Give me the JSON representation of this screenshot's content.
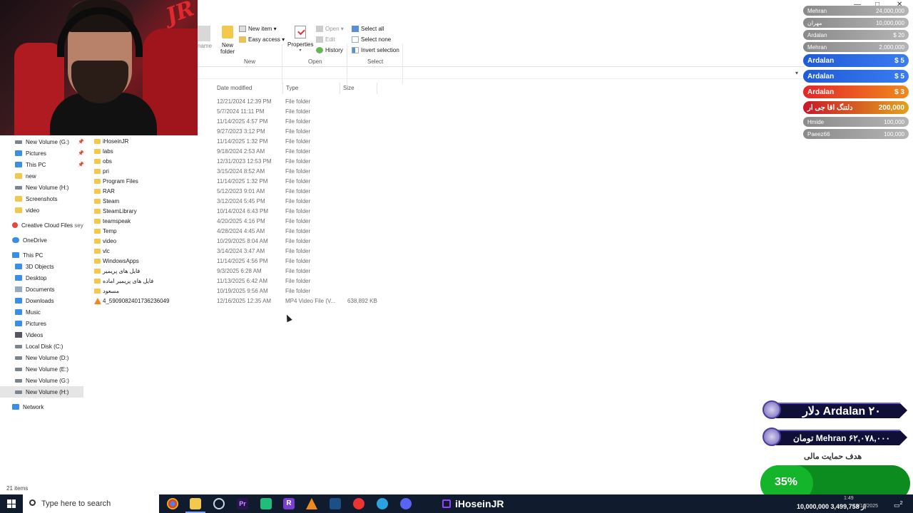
{
  "ribbon": {
    "new_folder": "New\nfolder",
    "new_item": "New item ▾",
    "easy_access": "Easy access ▾",
    "group_new": "New",
    "properties": "Properties",
    "open": "Open ▾",
    "edit": "Edit",
    "history": "History",
    "group_open": "Open",
    "select_all": "Select all",
    "select_none": "Select none",
    "invert_selection": "Invert selection",
    "group_select": "Select",
    "rename_partial": "name"
  },
  "columns": {
    "date": "Date modified",
    "type": "Type",
    "size": "Size"
  },
  "nav": {
    "items": [
      {
        "label": "New Volume (G:)",
        "icon": "drive-icon",
        "pinned": true
      },
      {
        "label": "Pictures",
        "icon": "pictures-icon",
        "pinned": true
      },
      {
        "label": "This PC",
        "icon": "pc-icon",
        "pinned": true
      },
      {
        "label": "new",
        "icon": "folder-icon"
      },
      {
        "label": "New Volume (H:)",
        "icon": "drive-icon"
      },
      {
        "label": "Screenshots",
        "icon": "folder-icon"
      },
      {
        "label": "video",
        "icon": "folder-icon"
      },
      {
        "label": "Creative Cloud Files",
        "icon": "creative-cloud-icon",
        "extra": "sey"
      },
      {
        "label": "OneDrive",
        "icon": "onedrive-icon"
      },
      {
        "label": "This PC",
        "icon": "pc-icon"
      },
      {
        "label": "3D Objects",
        "icon": "3d-objects-icon"
      },
      {
        "label": "Desktop",
        "icon": "desktop-icon"
      },
      {
        "label": "Documents",
        "icon": "documents-icon"
      },
      {
        "label": "Downloads",
        "icon": "downloads-icon"
      },
      {
        "label": "Music",
        "icon": "music-icon"
      },
      {
        "label": "Pictures",
        "icon": "pictures-icon"
      },
      {
        "label": "Videos",
        "icon": "videos-icon"
      },
      {
        "label": "Local Disk (C:)",
        "icon": "drive-icon"
      },
      {
        "label": "New Volume (D:)",
        "icon": "drive-icon"
      },
      {
        "label": "New Volume (E:)",
        "icon": "drive-icon"
      },
      {
        "label": "New Volume (G:)",
        "icon": "drive-icon"
      },
      {
        "label": "New Volume (H:)",
        "icon": "drive-icon",
        "selected": true
      },
      {
        "label": "Network",
        "icon": "network-icon"
      }
    ]
  },
  "files": [
    {
      "name": "",
      "date": "12/21/2024 12:39 PM",
      "type": "File folder",
      "size": ""
    },
    {
      "name": "",
      "date": "5/7/2024 11:11 PM",
      "type": "File folder",
      "size": ""
    },
    {
      "name": "",
      "date": "11/14/2025 4:57 PM",
      "type": "File folder",
      "size": ""
    },
    {
      "name": "",
      "date": "9/27/2023 3:12 PM",
      "type": "File folder",
      "size": ""
    },
    {
      "name": "iHoseinJR",
      "date": "11/14/2025 1:32 PM",
      "type": "File folder",
      "size": ""
    },
    {
      "name": "labs",
      "date": "9/18/2024 2:53 AM",
      "type": "File folder",
      "size": ""
    },
    {
      "name": "obs",
      "date": "12/31/2023 12:53 PM",
      "type": "File folder",
      "size": ""
    },
    {
      "name": "pri",
      "date": "3/15/2024 8:52 AM",
      "type": "File folder",
      "size": ""
    },
    {
      "name": "Program Files",
      "date": "11/14/2025 1:32 PM",
      "type": "File folder",
      "size": ""
    },
    {
      "name": "RAR",
      "date": "5/12/2023 9:01 AM",
      "type": "File folder",
      "size": ""
    },
    {
      "name": "Steam",
      "date": "3/12/2024 5:45 PM",
      "type": "File folder",
      "size": ""
    },
    {
      "name": "SteamLibrary",
      "date": "10/14/2024 6:43 PM",
      "type": "File folder",
      "size": ""
    },
    {
      "name": "teamspeak",
      "date": "4/20/2025 4:16 PM",
      "type": "File folder",
      "size": ""
    },
    {
      "name": "Temp",
      "date": "4/28/2024 4:45 AM",
      "type": "File folder",
      "size": ""
    },
    {
      "name": "video",
      "date": "10/29/2025 8:04 AM",
      "type": "File folder",
      "size": ""
    },
    {
      "name": "vlc",
      "date": "3/14/2024 3:47 AM",
      "type": "File folder",
      "size": ""
    },
    {
      "name": "WindowsApps",
      "date": "11/14/2025 4:56 PM",
      "type": "File folder",
      "size": ""
    },
    {
      "name": "فایل های پریمیر",
      "date": "9/3/2025 6:28 AM",
      "type": "File folder",
      "size": ""
    },
    {
      "name": "فایل های پریمیر اماده",
      "date": "11/13/2025 6:42 AM",
      "type": "File folder",
      "size": ""
    },
    {
      "name": "مسعود",
      "date": "10/19/2025 9:56 AM",
      "type": "File folder",
      "size": ""
    },
    {
      "name": "4_5909082401736236049",
      "date": "12/16/2025 12:35 AM",
      "type": "MP4 Video File (V...",
      "size": "638,892 KB",
      "vlc": true
    }
  ],
  "status": {
    "items": "21 items"
  },
  "donations": [
    {
      "name": "Mehran",
      "amount": "24,000,000"
    },
    {
      "name": "مهران",
      "amount": "10,000,000"
    },
    {
      "name": "Ardalan",
      "amount": "$ 20"
    },
    {
      "name": "Mehran",
      "amount": "2,000,000"
    },
    {
      "name": "Ardalan",
      "amount": "$ 5",
      "style": "blue"
    },
    {
      "name": "Ardalan",
      "amount": "$ 5",
      "style": "blue"
    },
    {
      "name": "Ardalan",
      "amount": "$ 3",
      "style": "orange"
    },
    {
      "name": "دلتنگ اقا جی ار",
      "amount": "200,000",
      "style": "orgred"
    },
    {
      "name": "Hmide",
      "amount": "100,000"
    },
    {
      "name": "Paeez66",
      "amount": "100,000"
    }
  ],
  "top_donors": {
    "line1": "Ardalan ۲۰ دلار",
    "line2": "Mehran ۶۲,۰۷۸,۰۰۰ تومان",
    "goal_label": "هدف حمایت مالی",
    "goal_percent": "35%",
    "goal_fraction": 0.35
  },
  "webcam": {
    "logo": "JR"
  },
  "taskbar": {
    "search_placeholder": "Type here to search",
    "brand": "iHoseinJR",
    "ticker": "10,000,000 از 3,499,758",
    "time": "1:49",
    "date": "12/16/2025",
    "notifications": "2"
  },
  "colors": {
    "accent": "#3a8ee6",
    "twitch": "#9146ff",
    "goal": "#14b52b"
  }
}
